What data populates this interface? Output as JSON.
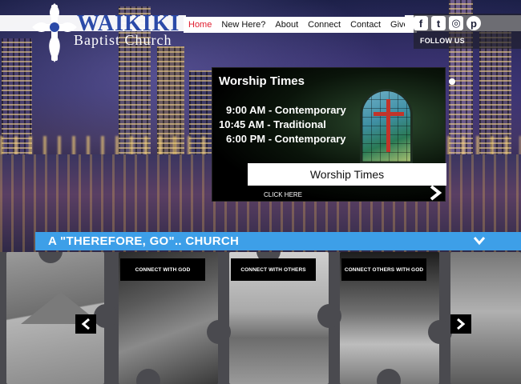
{
  "brand": {
    "name_line1": "WAIKIKI",
    "name_line2": "Baptist Church"
  },
  "nav": {
    "items": [
      {
        "label": "Home",
        "active": true
      },
      {
        "label": "New Here?",
        "active": false
      },
      {
        "label": "About",
        "active": false
      },
      {
        "label": "Connect",
        "active": false
      },
      {
        "label": "Contact",
        "active": false
      },
      {
        "label": "Give",
        "active": false
      }
    ]
  },
  "social": {
    "icons": [
      "facebook-icon",
      "twitter-icon",
      "instagram-icon",
      "pinterest-icon"
    ],
    "glyphs": [
      "f",
      "t",
      "◎",
      "p"
    ],
    "follow_label": "FOLLOW US"
  },
  "worship": {
    "title": "Worship Times",
    "times": [
      "9:00 AM - Contemporary",
      "10:45 AM - Traditional",
      "6:00 PM - Contemporary"
    ],
    "button_label": "Worship Times",
    "click_here": "CLICK HERE"
  },
  "banner": {
    "title": "A \"THEREFORE, GO\".. CHURCH"
  },
  "tiles": {
    "labels": [
      "CONNECT WITH GOD",
      "CONNECT WITH OTHERS",
      "CONNECT OTHERS WITH GOD"
    ]
  },
  "colors": {
    "accent_blue": "#3d9fe8",
    "nav_active": "#e01c2e",
    "brand_blue": "#2b4aa8"
  }
}
